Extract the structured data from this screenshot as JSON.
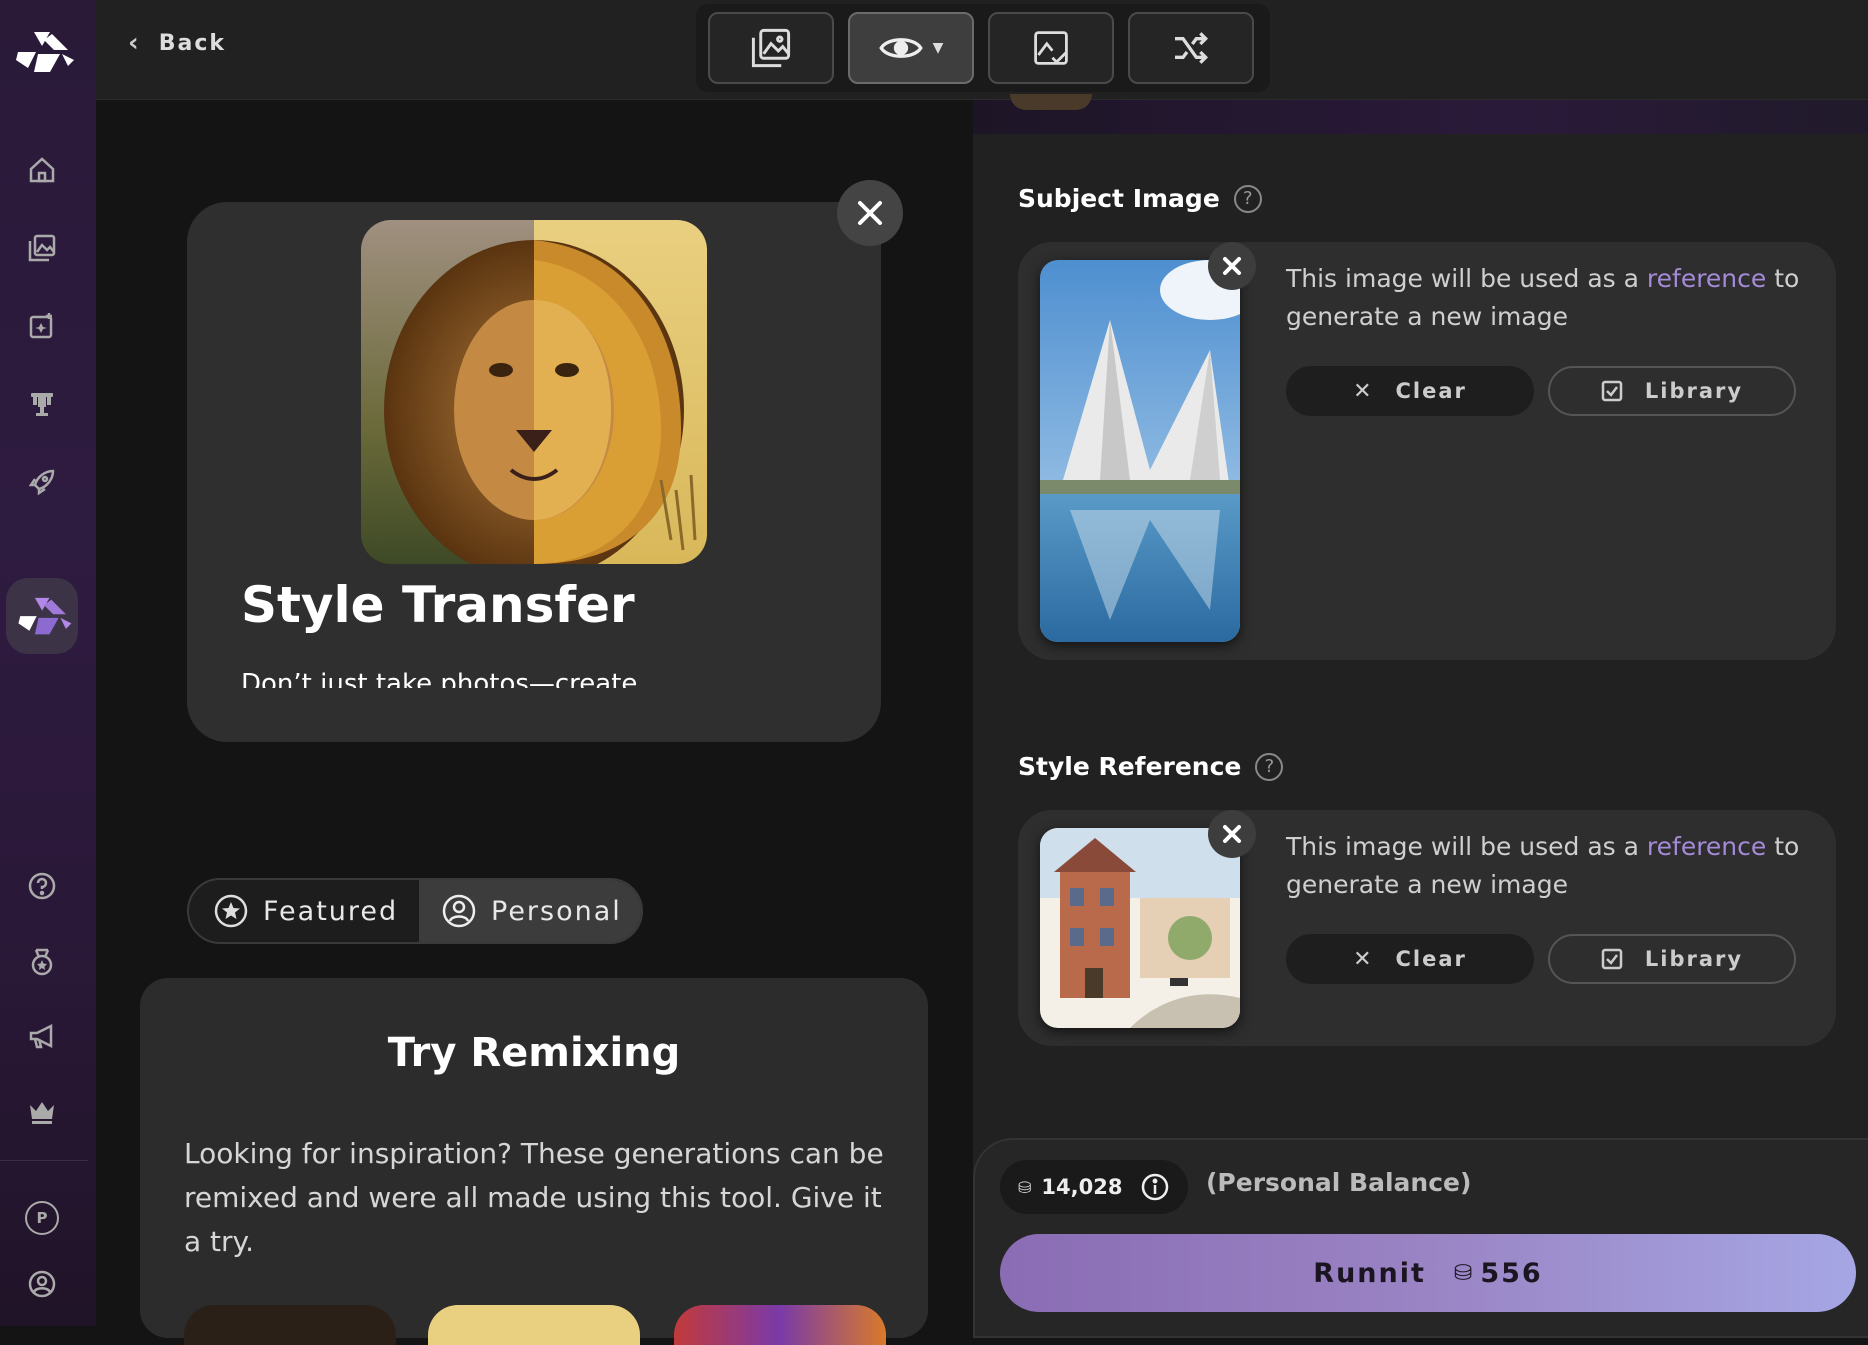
{
  "topbar": {
    "back_label": "Back"
  },
  "tools": [
    "gallery-icon",
    "eye-dropdown-icon",
    "image-check-icon",
    "shuffle-icon"
  ],
  "sidebar": {
    "items": [
      "home-icon",
      "images-icon",
      "sparkle-image-icon",
      "trophy-icon",
      "rocket-icon",
      "app-logo-icon",
      "help-icon",
      "medal-icon",
      "megaphone-icon",
      "crown-icon",
      "p-badge-icon",
      "profile-icon"
    ],
    "profile_badge": "P"
  },
  "hero": {
    "title": "Style Transfer",
    "description": "Don’t just take photos—create"
  },
  "segment": {
    "featured": "Featured",
    "personal": "Personal",
    "selected": "Personal"
  },
  "remix": {
    "title": "Try Remixing",
    "description": "Looking for inspiration? These generations can be remixed and were all made using this tool. Give it a try."
  },
  "subject": {
    "label": "Subject Image",
    "text_before": "This image will be used as a ",
    "link": "reference",
    "text_after": " to generate a new image",
    "clear": "Clear",
    "library": "Library"
  },
  "style_ref": {
    "label": "Style Reference",
    "text_before": "This image will be used as a ",
    "link": "reference",
    "text_after": " to generate a new image",
    "clear": "Clear",
    "library": "Library"
  },
  "run": {
    "balance": "14,028",
    "balance_label": "(Personal Balance)",
    "button_label": "Runnit",
    "cost": "556"
  },
  "colors": {
    "accent": "#9a84c4",
    "link": "#a58ad8"
  }
}
